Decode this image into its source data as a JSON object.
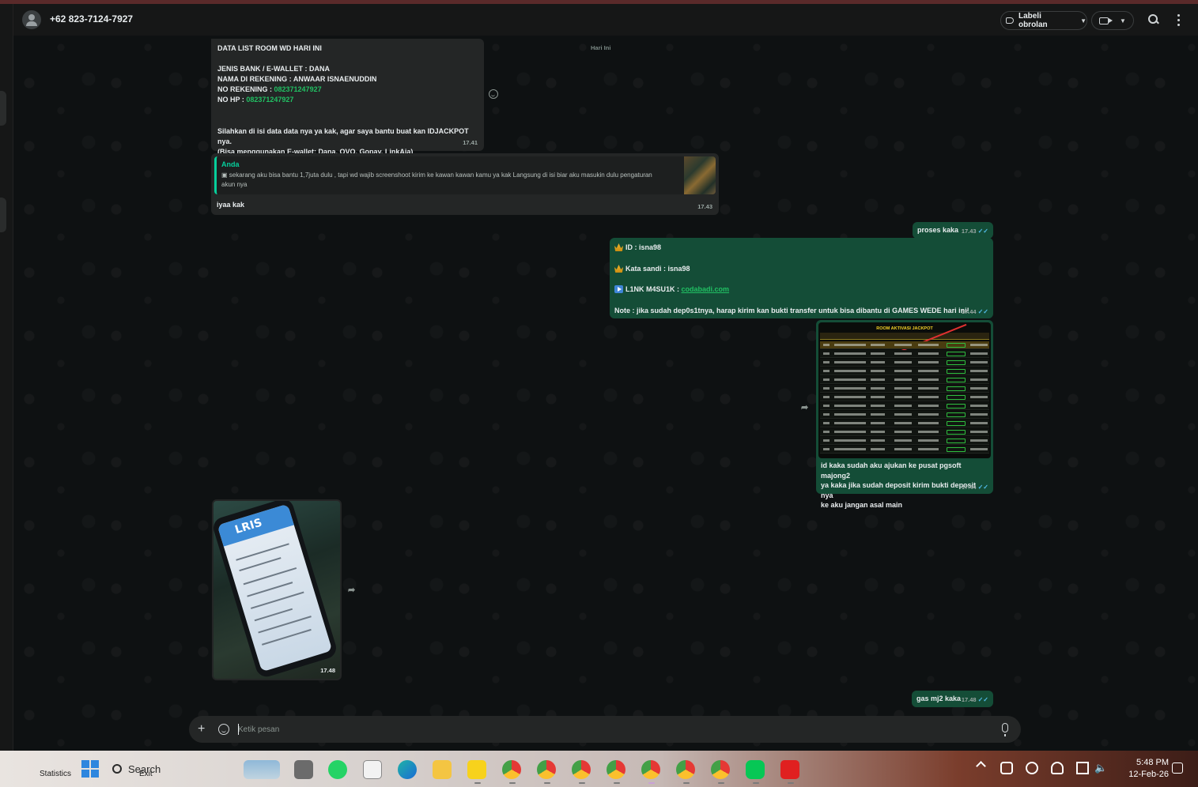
{
  "header": {
    "contact": "+62 823-7124-7927",
    "label_button": "Labeli obrolan"
  },
  "day_divider": "Hari Ini",
  "messages": {
    "m1": {
      "text_a": "DATA LIST ROOM WD HARI INI",
      "text_b": "JENIS BANK / E-WALLET : DANA",
      "text_c": "NAMA DI REKENING : ANWAAR ISNAENUDDIN",
      "text_d": "NO REKENING : ",
      "number_1": "082371247927",
      "text_e": "NO HP : ",
      "number_2": "082371247927",
      "text_f": "Silahkan di isi data data nya ya kak, agar saya bantu buat kan IDJACKPOT nya.",
      "text_g": "(Bisa menggunakan E-wallet: Dana, OVO, Gopay, LinkAja)",
      "time": "17.41"
    },
    "m2": {
      "quote_author": "Anda",
      "quote_text": "sekarang aku bisa bantu 1,7juta dulu , tapi wd wajib screenshoot kirim ke kawan kawan kamu ya kak Langsung di isi biar aku masukin dulu pengaturan akun nya",
      "text": "iyaa kak",
      "time": "17.43"
    },
    "m3": {
      "text": "proses kaka",
      "time": "17.43"
    },
    "m4": {
      "line_1": "ID :  isna98",
      "line_2": "Kata sandi : isna98",
      "line_3_label": "L1NK M4SU1K : ",
      "line_3_link": "codabadi.com",
      "line_4": "Note : jika sudah dep0s1tnya, harap kirim kan bukti transfer untuk bisa dibantu di GAMES WEDE hari ini!",
      "time": "17.44"
    },
    "m5": {
      "image_title": "ROOM AKTIVASI JACKPOT",
      "caption": "id kaka sudah aku ajukan ke pusat pgsoft majong2\nya kaka jika sudah deposit kirim bukti deposit nya\nke aku jangan asal main",
      "time": "17.44"
    },
    "m6": {
      "image_brand": "LRIS",
      "time": "17.48"
    },
    "m7": {
      "text": "gas mj2 kaka",
      "time": "17.48"
    }
  },
  "composer": {
    "placeholder": "Ketik pesan"
  },
  "taskbar": {
    "search_label": "Search",
    "ghost_1": "Statistics",
    "ghost_2": "Exit",
    "time": "5:48 PM",
    "date": "12-Feb-26"
  },
  "colors": {
    "incoming_bubble": "#242626",
    "outgoing_bubble": "#144d37",
    "accent_green": "#21c063"
  }
}
